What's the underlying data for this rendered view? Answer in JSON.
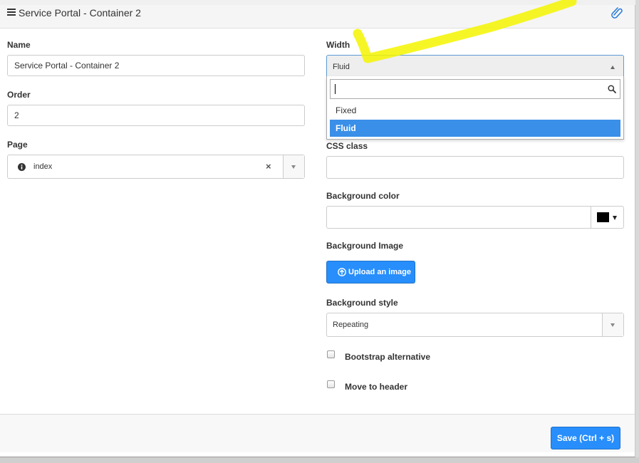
{
  "header": {
    "title": "Service Portal - Container 2",
    "menu_icon": "menu-icon",
    "attachment_icon": "paperclip-icon"
  },
  "form": {
    "name": {
      "label": "Name",
      "value": "Service Portal - Container 2"
    },
    "order": {
      "label": "Order",
      "value": "2"
    },
    "page": {
      "label": "Page",
      "value": "index",
      "clear_symbol": "×",
      "info_icon": "info-icon"
    },
    "width": {
      "label": "Width",
      "value": "Fluid",
      "search_placeholder": "",
      "options": [
        {
          "label": "Fixed",
          "selected": false
        },
        {
          "label": "Fluid",
          "selected": true
        }
      ]
    },
    "css_class": {
      "label": "CSS class",
      "value": ""
    },
    "background_color": {
      "label": "Background color",
      "value": "",
      "swatch_color": "#000000"
    },
    "background_image": {
      "label": "Background Image",
      "button_label": "Upload an image"
    },
    "background_style": {
      "label": "Background style",
      "value": "Repeating"
    },
    "bootstrap_alternative": {
      "label": "Bootstrap alternative",
      "checked": false
    },
    "move_to_header": {
      "label": "Move to header",
      "checked": false
    }
  },
  "footer": {
    "save_label": "Save  (Ctrl + s)"
  },
  "colors": {
    "primary": "#278efc",
    "selected_option": "#3a8fe8",
    "highlight_annotation": "#f4f400"
  }
}
